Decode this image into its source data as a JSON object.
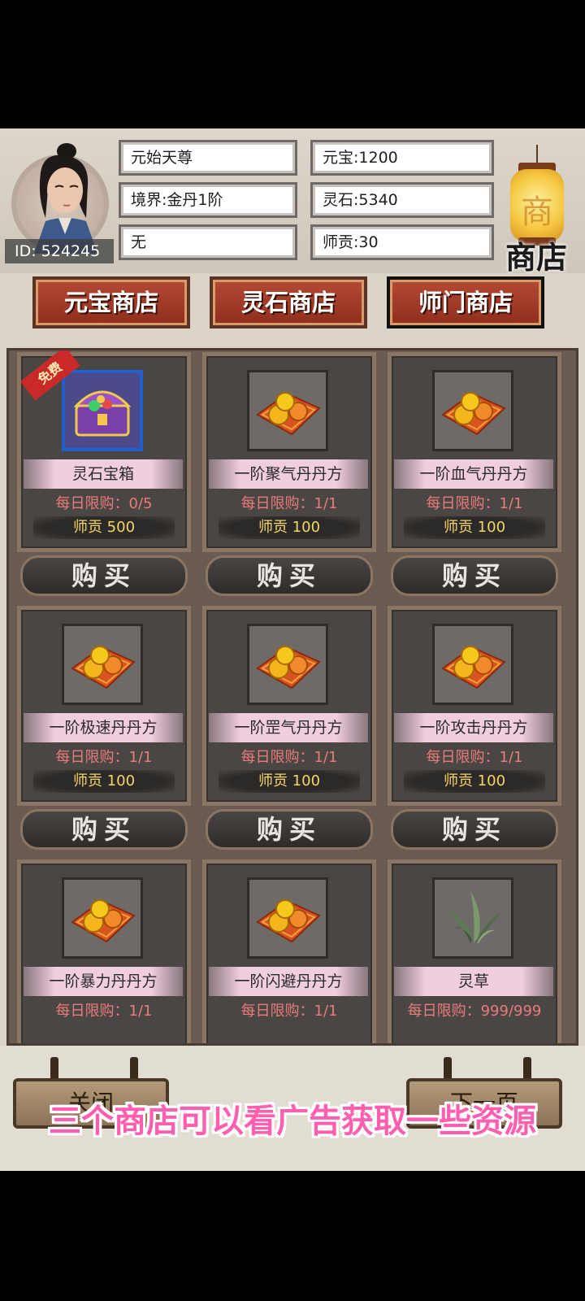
{
  "player": {
    "name": "元始天尊",
    "realm": "境界:金丹1阶",
    "sect": "无",
    "id_label": "ID: 524245",
    "yuanbao": "元宝:1200",
    "lingshi": "灵石:5340",
    "shigong": "师贡:30"
  },
  "shop_sign": {
    "glyph": "商",
    "label": "商店"
  },
  "tabs": [
    "元宝商店",
    "灵石商店",
    "师门商店"
  ],
  "active_tab": "师门商店",
  "items": [
    {
      "name": "灵石宝箱",
      "limit": "每日限购：0/5",
      "price": "师贡 500",
      "icon": "treasure-chest-icon",
      "badge": "免费",
      "buy": "购买"
    },
    {
      "name": "一阶聚气丹丹方",
      "limit": "每日限购：1/1",
      "price": "师贡 100",
      "icon": "pill-recipe-icon",
      "buy": "购买"
    },
    {
      "name": "一阶血气丹丹方",
      "limit": "每日限购：1/1",
      "price": "师贡 100",
      "icon": "pill-recipe-icon",
      "buy": "购买"
    },
    {
      "name": "一阶极速丹丹方",
      "limit": "每日限购：1/1",
      "price": "师贡 100",
      "icon": "pill-recipe-icon",
      "buy": "购买"
    },
    {
      "name": "一阶罡气丹丹方",
      "limit": "每日限购：1/1",
      "price": "师贡 100",
      "icon": "pill-recipe-icon",
      "buy": "购买"
    },
    {
      "name": "一阶攻击丹丹方",
      "limit": "每日限购：1/1",
      "price": "师贡 100",
      "icon": "pill-recipe-icon",
      "buy": "购买"
    },
    {
      "name": "一阶暴力丹丹方",
      "limit": "每日限购：1/1",
      "icon": "pill-recipe-icon"
    },
    {
      "name": "一阶闪避丹丹方",
      "limit": "每日限购：1/1",
      "icon": "pill-recipe-icon"
    },
    {
      "name": "灵草",
      "limit": "每日限购：999/999",
      "icon": "spirit-herb-icon"
    }
  ],
  "bottom": {
    "left_button": "关闭",
    "right_button": "下一页",
    "caption": "三个商店可以看广告获取一些资源"
  },
  "colors": {
    "tab_red": "#9c3a26",
    "price_gold": "#f5d667",
    "limit_red": "#e87b7b",
    "caption_pink": "#ff5fae"
  }
}
